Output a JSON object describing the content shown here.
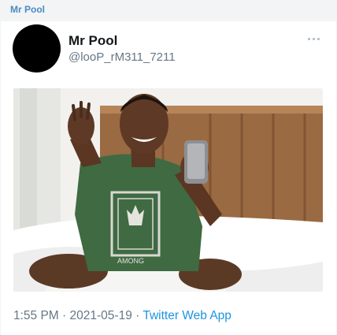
{
  "header": {
    "account_name": "Mr Pool"
  },
  "tweet": {
    "display_name": "Mr Pool",
    "handle": "@looP_rM311_7211",
    "more_icon": "more-dots-icon",
    "time": "1:55 PM",
    "separator": "·",
    "date": "2021-05-19",
    "source": "Twitter Web App",
    "shirt_text": "AMONG",
    "colors": {
      "link": "#1b95e0",
      "secondary_text": "#657786",
      "top_name": "#4a8bc0"
    }
  }
}
